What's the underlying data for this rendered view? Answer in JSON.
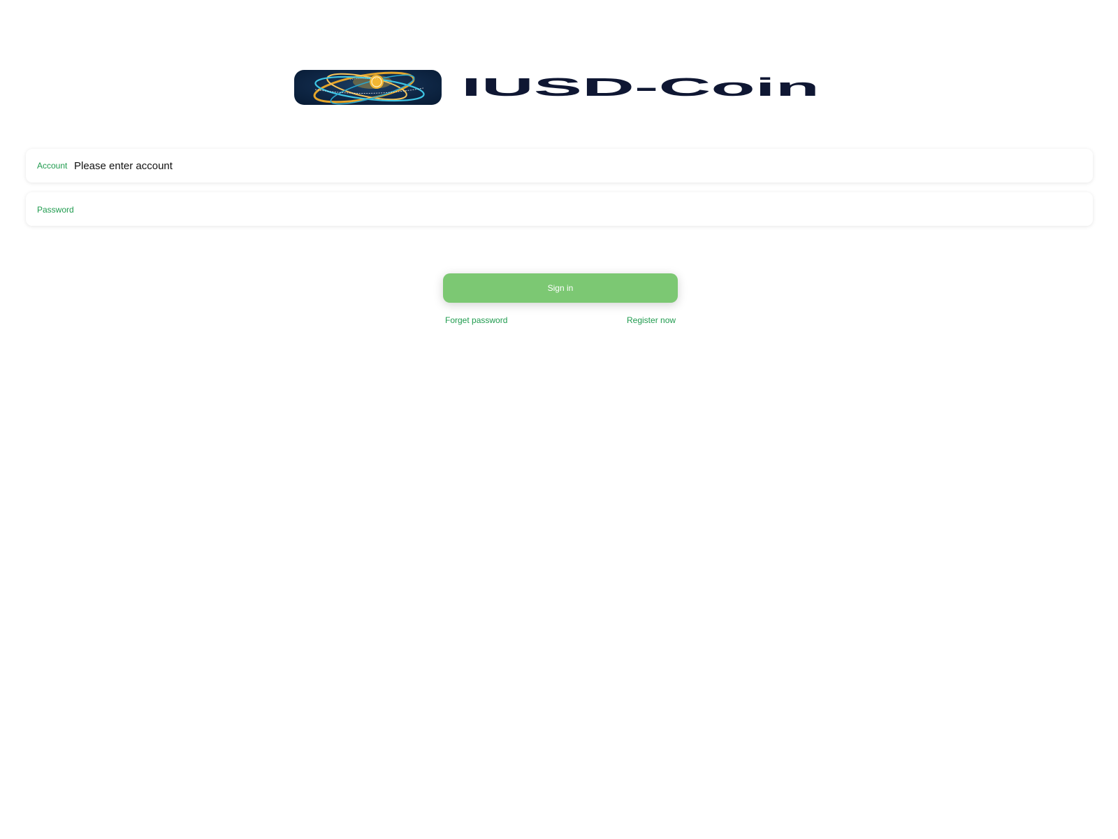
{
  "brand": {
    "name": "IUSD-Coin",
    "logo_icon": "globe-coin-logo",
    "wordmark_color": "#0f1733"
  },
  "form": {
    "account": {
      "label": "Account",
      "placeholder": "Please enter account",
      "value": ""
    },
    "password": {
      "label": "Password",
      "placeholder": "",
      "value": ""
    }
  },
  "actions": {
    "signin_label": "Sign in",
    "forget_label": "Forget password",
    "register_label": "Register now"
  },
  "colors": {
    "accent_green": "#1f9b4e",
    "button_green": "#7cc873",
    "logo_navy": "#0f2746",
    "logo_gold": "#f2b632",
    "logo_cyan": "#3fc7e6"
  }
}
